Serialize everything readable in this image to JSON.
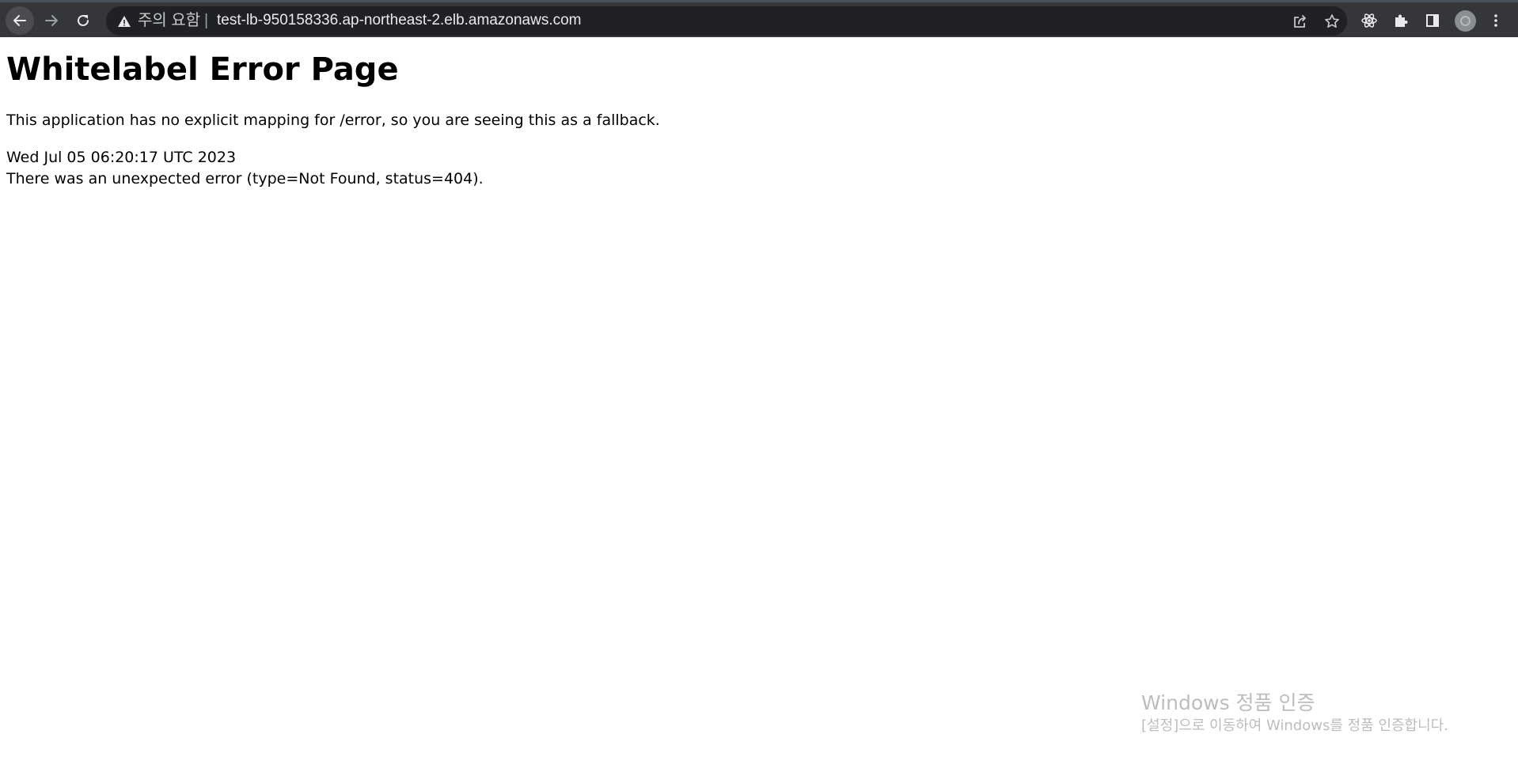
{
  "browser": {
    "address_bar": {
      "security_label": "주의 요함",
      "separator": "|",
      "url": "test-lb-950158336.ap-northeast-2.elb.amazonaws.com"
    },
    "colors": {
      "toolbar_bg": "#35363a",
      "omnibox_bg": "#202124",
      "text": "#e8eaed"
    }
  },
  "page": {
    "title": "Whitelabel Error Page",
    "description": "This application has no explicit mapping for /error, so you are seeing this as a fallback.",
    "timestamp": "Wed Jul 05 06:20:17 UTC 2023",
    "error_message": "There was an unexpected error (type=Not Found, status=404)."
  },
  "watermark": {
    "title": "Windows 정품 인증",
    "subtitle": "[설정]으로 이동하여 Windows를 정품 인증합니다."
  }
}
